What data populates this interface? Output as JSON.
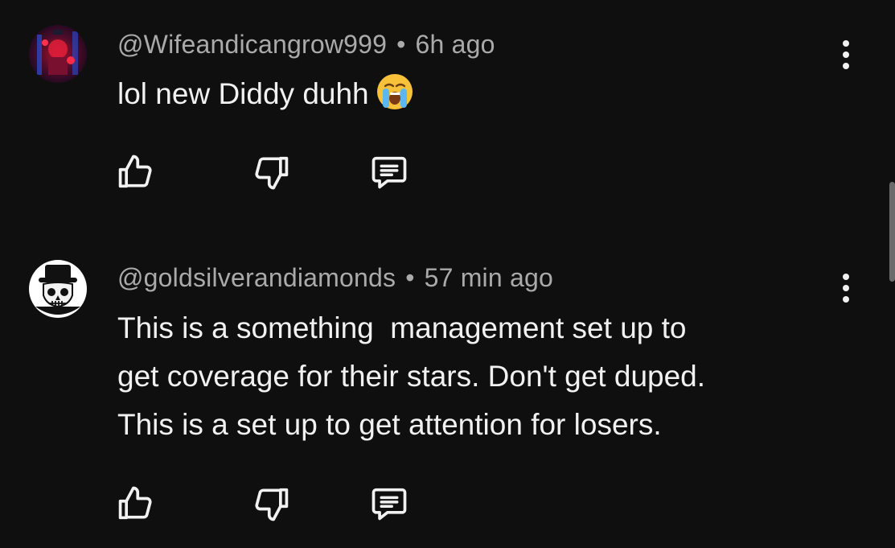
{
  "comments": [
    {
      "handle": "@Wifeandicangrow999",
      "separator": "•",
      "time": "6h ago",
      "text": "lol new Diddy duhh",
      "emoji": "crying-face",
      "avatar": "dark-red-collage-avatar"
    },
    {
      "handle": "@goldsilverandiamonds",
      "separator": "•",
      "time": "57 min ago",
      "text": "This is a something  management set up to\nget coverage for their stars. Don't get duped.\nThis is a set up to get attention for losers.",
      "avatar": "skull-top-hat-avatar"
    }
  ],
  "icons": {
    "like": "thumbs-up-icon",
    "dislike": "thumbs-down-icon",
    "reply": "comment-icon",
    "more": "more-vertical-icon"
  },
  "colors": {
    "background": "#0f0f0f",
    "text": "#f1f1f1",
    "meta": "#aaaaaa"
  }
}
